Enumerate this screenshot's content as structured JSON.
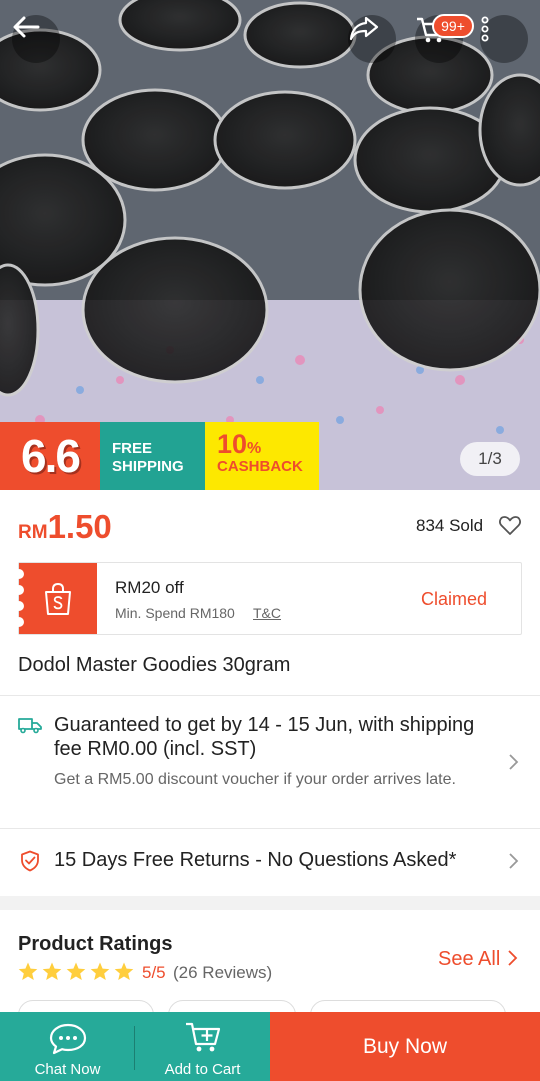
{
  "product": {
    "image_pager": "1/3",
    "promo": {
      "sale_label": "6.6",
      "free_shipping_line1": "FREE",
      "free_shipping_line2": "SHIPPING",
      "cashback_value": "10",
      "cashback_percent": "%",
      "cashback_label": "CASHBACK"
    },
    "currency": "RM",
    "price": "1.50",
    "sold": "834 Sold",
    "title": "Dodol Master Goodies 30gram"
  },
  "header": {
    "cart_count": "99+"
  },
  "voucher": {
    "title": "RM20 off",
    "min_spend": "Min. Spend RM180",
    "tc": "T&C",
    "status": "Claimed"
  },
  "shipping": {
    "main": "Guaranteed to get by 14 - 15 Jun, with shipping fee RM0.00 (incl. SST)",
    "sub": "Get a RM5.00 discount voucher if your order arrives late."
  },
  "returns": {
    "text": "15 Days Free Returns - No Questions Asked*"
  },
  "ratings": {
    "title": "Product Ratings",
    "score": "5/5",
    "count": "(26 Reviews)",
    "see_all": "See All",
    "stars": 5
  },
  "bottom_bar": {
    "chat": "Chat Now",
    "add_to_cart": "Add to Cart",
    "buy_now": "Buy Now"
  },
  "colors": {
    "brand": "#ee4d2d",
    "teal": "#26aa99",
    "star": "#ffce3d"
  },
  "icons": [
    "back-arrow-icon",
    "share-icon",
    "cart-icon",
    "more-icon",
    "heart-icon",
    "shopping-bag-icon",
    "truck-icon",
    "shield-icon",
    "chevron-right-icon",
    "star-icon",
    "chat-icon"
  ]
}
